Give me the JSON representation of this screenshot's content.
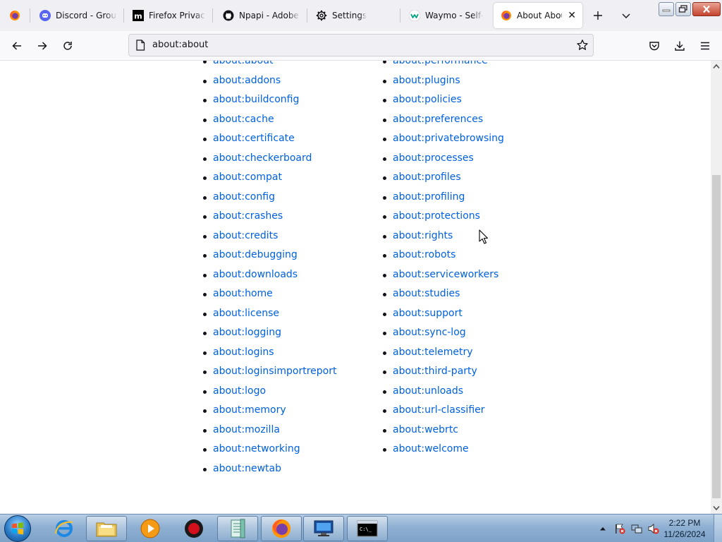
{
  "tabs": [
    {
      "title": "Discord - Group",
      "icon": "discord-icon"
    },
    {
      "title": "Firefox Privacy N",
      "icon": "mozilla-m-icon"
    },
    {
      "title": "Npapi - Adobe F",
      "icon": "github-icon"
    },
    {
      "title": "Settings",
      "icon": "gear-icon"
    },
    {
      "title": "Waymo - Self-Dr",
      "icon": "waymo-icon"
    },
    {
      "title": "About About",
      "icon": "firefox-icon",
      "active": true
    }
  ],
  "urlbar": {
    "value": "about:about"
  },
  "links_left": [
    "about:about",
    "about:addons",
    "about:buildconfig",
    "about:cache",
    "about:certificate",
    "about:checkerboard",
    "about:compat",
    "about:config",
    "about:crashes",
    "about:credits",
    "about:debugging",
    "about:downloads",
    "about:home",
    "about:license",
    "about:logging",
    "about:logins",
    "about:loginsimportreport",
    "about:logo",
    "about:memory",
    "about:mozilla",
    "about:networking",
    "about:newtab"
  ],
  "links_right": [
    "about:performance",
    "about:plugins",
    "about:policies",
    "about:preferences",
    "about:privatebrowsing",
    "about:processes",
    "about:profiles",
    "about:profiling",
    "about:protections",
    "about:rights",
    "about:robots",
    "about:serviceworkers",
    "about:studies",
    "about:support",
    "about:sync-log",
    "about:telemetry",
    "about:third-party",
    "about:unloads",
    "about:url-classifier",
    "about:webrtc",
    "about:welcome"
  ],
  "taskbar": {
    "items": [
      "internet-explorer-icon",
      "file-explorer-icon",
      "media-player-icon",
      "record-icon",
      "notepad-icon",
      "firefox-icon",
      "remote-desktop-icon",
      "command-prompt-icon"
    ]
  },
  "clock": {
    "time": "2:22 PM",
    "date": "11/26/2024"
  },
  "colors": {
    "link": "#0061e0",
    "tabstrip": "#f0f0f4",
    "taskbar": "#8fb0d2"
  }
}
